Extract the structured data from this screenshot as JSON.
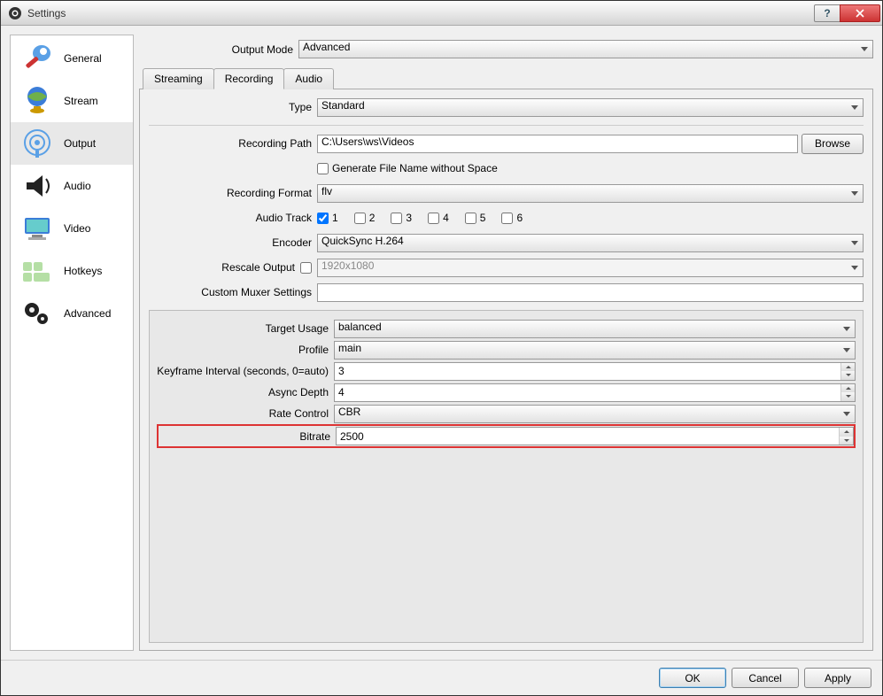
{
  "window": {
    "title": "Settings"
  },
  "titlebar_buttons": {
    "help": "?",
    "close": "X"
  },
  "sidebar": {
    "items": [
      {
        "id": "general",
        "label": "General"
      },
      {
        "id": "stream",
        "label": "Stream"
      },
      {
        "id": "output",
        "label": "Output",
        "selected": true
      },
      {
        "id": "audio",
        "label": "Audio"
      },
      {
        "id": "video",
        "label": "Video"
      },
      {
        "id": "hotkeys",
        "label": "Hotkeys"
      },
      {
        "id": "advanced",
        "label": "Advanced"
      }
    ]
  },
  "output_mode": {
    "label": "Output Mode",
    "value": "Advanced"
  },
  "tabs": {
    "streaming": "Streaming",
    "recording": "Recording",
    "audio": "Audio",
    "active": "recording"
  },
  "recording": {
    "type": {
      "label": "Type",
      "value": "Standard"
    },
    "path": {
      "label": "Recording Path",
      "value": "C:\\Users\\ws\\Videos",
      "browse": "Browse"
    },
    "gen_no_space": {
      "label": "Generate File Name without Space",
      "checked": false
    },
    "format": {
      "label": "Recording Format",
      "value": "flv"
    },
    "audio_track": {
      "label": "Audio Track",
      "tracks": [
        "1",
        "2",
        "3",
        "4",
        "5",
        "6"
      ],
      "checked": [
        true,
        false,
        false,
        false,
        false,
        false
      ]
    },
    "encoder": {
      "label": "Encoder",
      "value": "QuickSync H.264"
    },
    "rescale": {
      "label": "Rescale Output",
      "checked": false,
      "value": "1920x1080"
    },
    "muxer": {
      "label": "Custom Muxer Settings",
      "value": ""
    }
  },
  "encoder_settings": {
    "target_usage": {
      "label": "Target Usage",
      "value": "balanced"
    },
    "profile": {
      "label": "Profile",
      "value": "main"
    },
    "keyframe": {
      "label": "Keyframe Interval (seconds, 0=auto)",
      "value": "3"
    },
    "async_depth": {
      "label": "Async Depth",
      "value": "4"
    },
    "rate_control": {
      "label": "Rate Control",
      "value": "CBR"
    },
    "bitrate": {
      "label": "Bitrate",
      "value": "2500"
    }
  },
  "footer": {
    "ok": "OK",
    "cancel": "Cancel",
    "apply": "Apply"
  }
}
